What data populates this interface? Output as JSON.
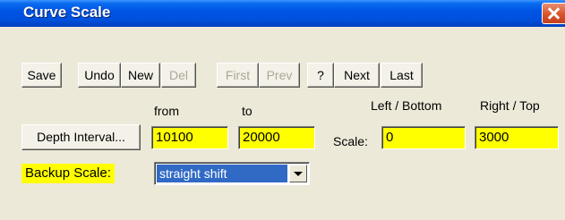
{
  "window": {
    "title": "Curve Scale"
  },
  "toolbar": {
    "save": "Save",
    "undo": "Undo",
    "new": "New",
    "del": "Del",
    "first": "First",
    "prev": "Prev",
    "help": "?",
    "next": "Next",
    "last": "Last"
  },
  "depth": {
    "button": "Depth Interval...",
    "from_label": "from",
    "to_label": "to",
    "from_value": "10100",
    "to_value": "20000"
  },
  "scale": {
    "label": "Scale:",
    "left_bottom_label": "Left / Bottom",
    "right_top_label": "Right / Top",
    "left_value": "0",
    "right_value": "3000"
  },
  "backup": {
    "label": "Backup Scale:",
    "selected": "straight shift"
  },
  "colors": {
    "highlight": "#ffff00",
    "title_bar": "#0054e3",
    "selection": "#316ac5"
  },
  "icons": {
    "close": "close-icon",
    "dropdown": "chevron-down-icon"
  }
}
